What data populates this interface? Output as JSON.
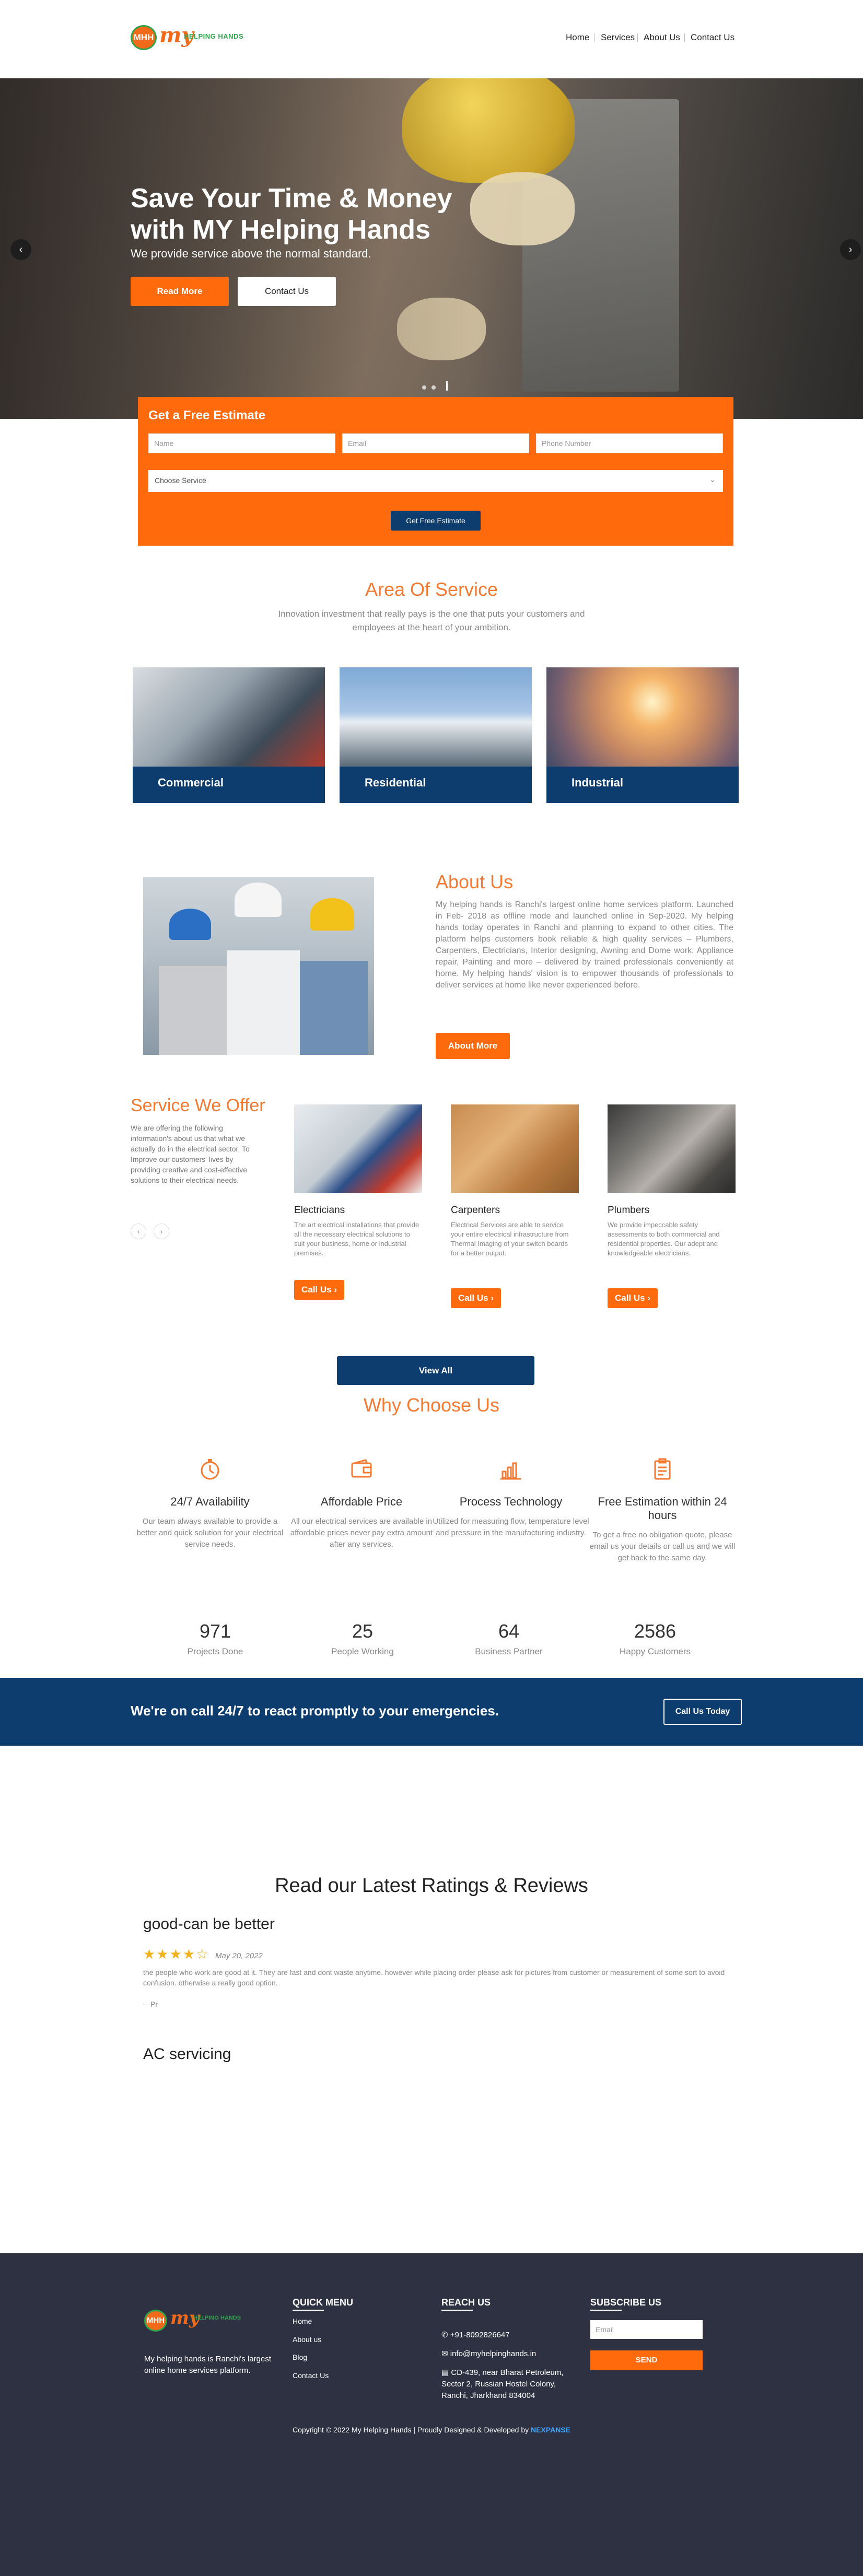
{
  "brand": {
    "logo_mark": "MHH",
    "logo_word": "my",
    "logo_sub": "HELPING HANDS"
  },
  "nav": {
    "items": [
      "Home",
      "Services",
      "About Us",
      "Contact Us"
    ]
  },
  "hero": {
    "title": "Save Your Time & Money with MY Helping Hands",
    "subtitle": "We provide service above the normal standard.",
    "read_more": "Read More",
    "contact_us": "Contact Us",
    "prev_icon": "chevron-left-icon",
    "next_icon": "chevron-right-icon"
  },
  "estimate": {
    "title": "Get a Free Estimate",
    "name_placeholder": "Name",
    "email_placeholder": "Email",
    "phone_placeholder": "Phone Number",
    "service_select": "Choose Service",
    "button": "Get Free Estimate"
  },
  "area": {
    "title": "Area Of Service",
    "subtitle": "Innovation investment that really pays is the one that puts your customers and employees at the heart of your ambition.",
    "cards": [
      {
        "label": "Commercial"
      },
      {
        "label": "Residential"
      },
      {
        "label": "Industrial"
      }
    ]
  },
  "about": {
    "title": "About Us",
    "text": "My helping hands is Ranchi's largest online home services platform. Launched in Feb- 2018 as offline mode and launched online in Sep-2020. My helping hands today operates in Ranchi and planning to expand to other cities. The platform helps customers book reliable & high quality services – Plumbers, Carpenters, Electricians, Interior designing, Awning and Dome work, Appliance repair, Painting and more – delivered by trained professionals conveniently at home. My helping hands' vision is to empower thousands of professionals to deliver services at home like never experienced before.",
    "button": "About More"
  },
  "services": {
    "title": "Service We Offer",
    "text": "We are offering the following information's about us that what we actually do in the electrical sector. To Improve our customers' lives by providing creative and cost-effective solutions to their electrical needs.",
    "prev": "‹",
    "next": "›",
    "cards": [
      {
        "name": "Electricians",
        "desc": "The art electrical installations that provide all the necessary electrical solutions to suit your business, home or industrial premises.",
        "button": "Call Us"
      },
      {
        "name": "Carpenters",
        "desc": "Electrical Services are able to service your entire electrical infrastructure from Thermal Imaging of your switch boards for a better output.",
        "button": "Call Us"
      },
      {
        "name": "Plumbers",
        "desc": "We provide impeccable safety assessments to both commercial and residential properties. Our adept and knowledgeable electricians.",
        "button": "Call Us"
      }
    ],
    "view_all": "View All"
  },
  "why": {
    "title": "Why Choose Us",
    "items": [
      {
        "icon": "clock-icon",
        "name": "24/7 Availability",
        "desc": "Our team always available to provide a better and quick solution for your electrical service needs."
      },
      {
        "icon": "wallet-icon",
        "name": "Affordable Price",
        "desc": "All our electrical services are available in affordable prices never pay extra amount after any services."
      },
      {
        "icon": "bar-chart-icon",
        "name": "Process Technology",
        "desc": "Utilized for measuring flow, temperature level and pressure in the manufacturing industry."
      },
      {
        "icon": "clipboard-icon",
        "name": "Free Estimation within 24 hours",
        "desc": "To get a free no obligation quote, please email us your details or call us and we will get back to the same day."
      }
    ],
    "stats": [
      {
        "num": "971",
        "label": "Projects Done"
      },
      {
        "num": "25",
        "label": "People Working"
      },
      {
        "num": "64",
        "label": "Business Partner"
      },
      {
        "num": "2586",
        "label": "Happy Customers"
      }
    ]
  },
  "callband": {
    "text": "We're on call 24/7 to react promptly to your emergencies.",
    "button": "Call Us Today"
  },
  "reviews": {
    "title": "Read our Latest Ratings & Reviews",
    "items": [
      {
        "heading": "good-can be better",
        "stars": "★★★★☆",
        "date": "May 20, 2022",
        "body": "the people who work are good at it. They are fast and dont waste anytime. however while placing order please ask for pictures from customer or measurement of some sort to avoid confusion. otherwise a really good option.",
        "author": "—Pr"
      },
      {
        "heading": "AC servicing"
      }
    ]
  },
  "footer": {
    "about": "My helping hands is Ranchi's largest online home services platform.",
    "quick_menu": {
      "title": "QUICK MENU",
      "links": [
        "Home",
        "About us",
        "Blog",
        "Contact Us"
      ]
    },
    "reach": {
      "title": "REACH US",
      "phone": "+91-8092826647",
      "email": "info@myhelpinghands.in",
      "address": "CD-439, near Bharat Petroleum, Sector 2, Russian Hostel Colony, Ranchi, Jharkhand 834004"
    },
    "subscribe": {
      "title": "SUBSCRIBE US",
      "email_placeholder": "Email",
      "button": "SEND"
    },
    "copyright": "Copyright © 2022 My Helping Hands | Proudly Designed & Developed by",
    "developer": "NEXPANSE"
  }
}
